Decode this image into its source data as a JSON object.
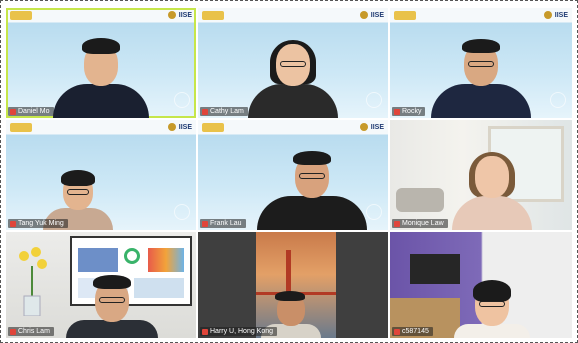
{
  "participants": [
    {
      "name": "Daniel Mo"
    },
    {
      "name": "Cathy Lam"
    },
    {
      "name": "Rocky"
    },
    {
      "name": "Tang Yuk Ming"
    },
    {
      "name": "Frank Lau"
    },
    {
      "name": "Monique Law"
    },
    {
      "name": "Chris Lam"
    },
    {
      "name": "Harry U, Hong Kong"
    },
    {
      "name": "c587145"
    }
  ],
  "branding": {
    "org": "IISE"
  },
  "colors": {
    "active_speaker_border": "#c6e64a",
    "mic_muted": "#e0453a"
  }
}
